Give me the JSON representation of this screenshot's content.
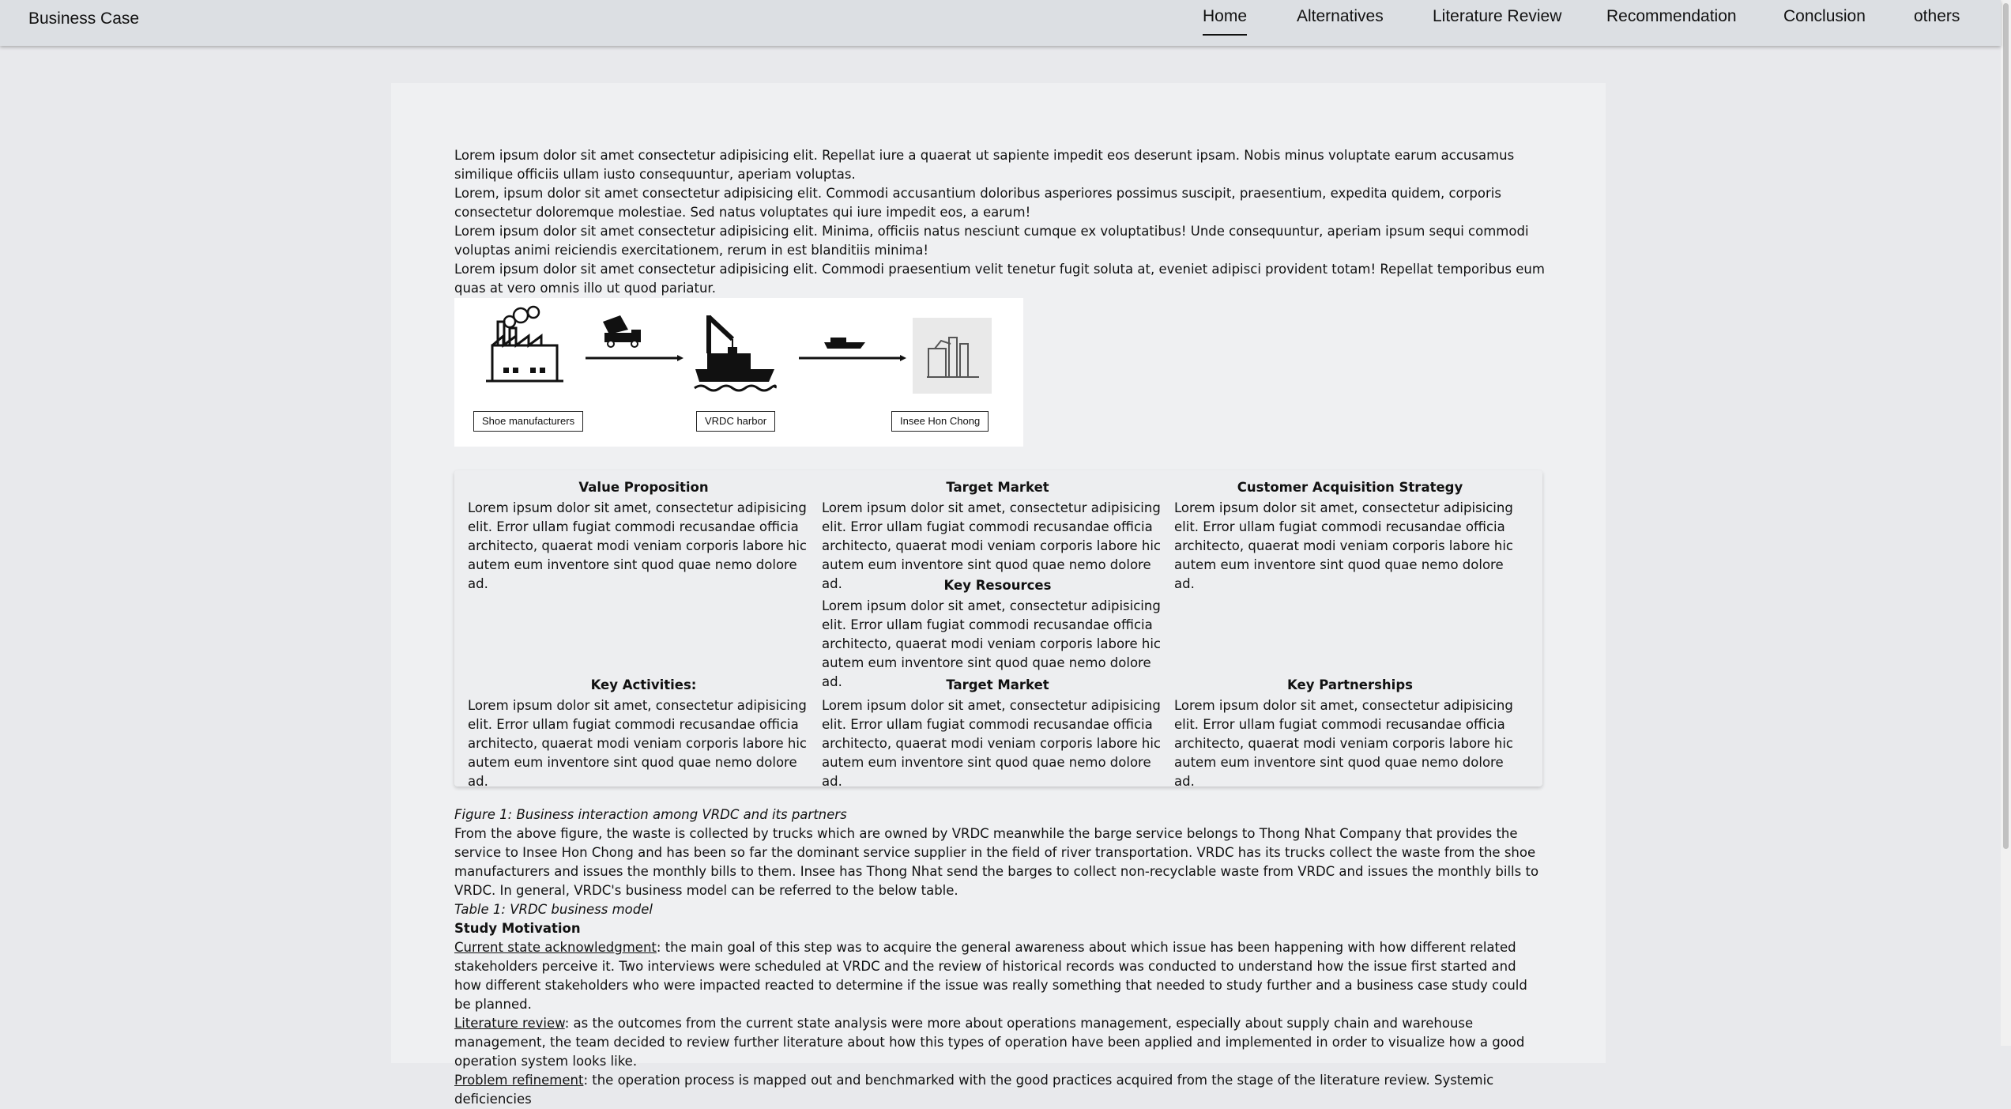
{
  "header": {
    "brand": "Business Case",
    "nav": [
      "Home",
      "Alternatives",
      "Literature Review",
      "Recommendation",
      "Conclusion",
      "others"
    ]
  },
  "intro": [
    "Lorem ipsum dolor sit amet consectetur adipisicing elit. Repellat iure a quaerat ut sapiente impedit eos deserunt ipsam. Nobis minus voluptate earum accusamus similique officiis ullam iusto consequuntur, aperiam voluptas.",
    "Lorem, ipsum dolor sit amet consectetur adipisicing elit. Commodi accusantium doloribus asperiores possimus suscipit, praesentium, expedita quidem, corporis consectetur doloremque molestiae. Sed natus voluptates qui iure impedit eos, a earum!",
    "Lorem ipsum dolor sit amet consectetur adipisicing elit. Minima, officiis natus nesciunt cumque ex voluptatibus! Unde consequuntur, aperiam ipsum sequi commodi voluptas animi reiciendis exercitationem, rerum in est blanditiis minima!",
    "Lorem ipsum dolor sit amet consectetur adipisicing elit. Commodi praesentium velit tenetur fugit soluta at, eveniet adipisci provident totam! Repellat temporibus eum quas at vero omnis illo ut quod pariatur."
  ],
  "diagram": {
    "labels": [
      "Shoe manufacturers",
      "VRDC harbor",
      "Insee Hon Chong"
    ]
  },
  "business_model": {
    "row1": [
      {
        "title": "Value Proposition",
        "text": "Lorem ipsum dolor sit amet, consectetur adipisicing elit. Error ullam fugiat commodi recusandae officia architecto, quaerat modi veniam corporis labore hic autem eum inventore sint quod quae nemo dolore ad."
      },
      {
        "title": "Target Market",
        "text": "Lorem ipsum dolor sit amet, consectetur adipisicing elit. Error ullam fugiat commodi recusandae officia architecto, quaerat modi veniam corporis labore hic autem eum inventore sint quod quae nemo dolore ad."
      },
      {
        "title": "Customer Acquisition Strategy",
        "text": "Lorem ipsum dolor sit amet, consectetur adipisicing elit. Error ullam fugiat commodi recusandae officia architecto, quaerat modi veniam corporis labore hic autem eum inventore sint quod quae nemo dolore ad."
      }
    ],
    "middle": {
      "title": "Key Resources",
      "text": "Lorem ipsum dolor sit amet, consectetur adipisicing elit. Error ullam fugiat commodi recusandae officia architecto, quaerat modi veniam corporis labore hic autem eum inventore sint quod quae nemo dolore ad."
    },
    "row3": [
      {
        "title": "Key Activities:",
        "text": "Lorem ipsum dolor sit amet, consectetur adipisicing elit. Error ullam fugiat commodi recusandae officia architecto, quaerat modi veniam corporis labore hic autem eum inventore sint quod quae nemo dolore ad."
      },
      {
        "title": "Target Market",
        "text": "Lorem ipsum dolor sit amet, consectetur adipisicing elit. Error ullam fugiat commodi recusandae officia architecto, quaerat modi veniam corporis labore hic autem eum inventore sint quod quae nemo dolore ad."
      },
      {
        "title": "Key Partnerships",
        "text": "Lorem ipsum dolor sit amet, consectetur adipisicing elit. Error ullam fugiat commodi recusandae officia architecto, quaerat modi veniam corporis labore hic autem eum inventore sint quod quae nemo dolore ad."
      }
    ]
  },
  "figure_caption": "Figure 1: Business interaction among VRDC and its partners",
  "figure_text": "From the above figure, the waste is collected by trucks which are owned by VRDC meanwhile the barge service belongs to Thong Nhat Company that provides the service to Insee Hon Chong and has been so far the dominant service supplier in the field of river transportation. VRDC has its trucks collect the waste from the shoe manufacturers and issues the monthly bills to them. Insee has Thong Nhat send the barges to collect non-recyclable waste from VRDC and issues the monthly bills to VRDC. In general, VRDC's business model can be referred to the below table.",
  "table_caption": "Table 1: VRDC business model",
  "study": {
    "heading": "Study Motivation",
    "items": [
      {
        "term": "Current state acknowledgment",
        "text": ": the main goal of this step was to acquire the general awareness about which issue has been happening with how different related stakeholders perceive it. Two interviews were scheduled at VRDC and the review of historical records was conducted to understand how the issue first started and how different stakeholders who were impacted reacted to determine if the issue was really something that needed to study further and a business case study could be planned."
      },
      {
        "term": "Literature review",
        "text": ": as the outcomes from the current state analysis were more about operations management, especially about supply chain and warehouse management, the team decided to review further literature about how this types of operation have been applied and implemented in order to visualize how a good operation system looks like."
      },
      {
        "term": "Problem refinement",
        "text": ": the operation process is mapped out and benchmarked with the good practices acquired from the stage of the literature review. Systemic deficiencies"
      }
    ]
  }
}
